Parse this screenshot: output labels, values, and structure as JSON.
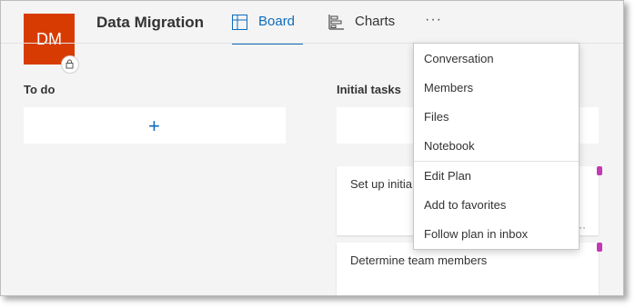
{
  "header": {
    "avatar_initials": "DM",
    "title": "Data Migration",
    "tabs": [
      {
        "label": "Board",
        "icon": "board-icon",
        "active": true
      },
      {
        "label": "Charts",
        "icon": "charts-icon",
        "active": false
      }
    ],
    "more_label": "···"
  },
  "columns": [
    {
      "title": "To do",
      "add_label": "+"
    },
    {
      "title": "Initial tasks"
    }
  ],
  "tasks": [
    {
      "title": "Set up initia",
      "more": "···",
      "label_color": "#c239b3"
    },
    {
      "title": "Determine team members",
      "more": "···",
      "label_color": "#c239b3"
    }
  ],
  "menu": {
    "items": [
      "Conversation",
      "Members",
      "Files",
      "Notebook",
      "Edit Plan",
      "Add to favorites",
      "Follow plan in inbox"
    ]
  },
  "colors": {
    "accent": "#0f6cbd",
    "avatar_bg": "#d83b01",
    "label": "#c239b3"
  }
}
